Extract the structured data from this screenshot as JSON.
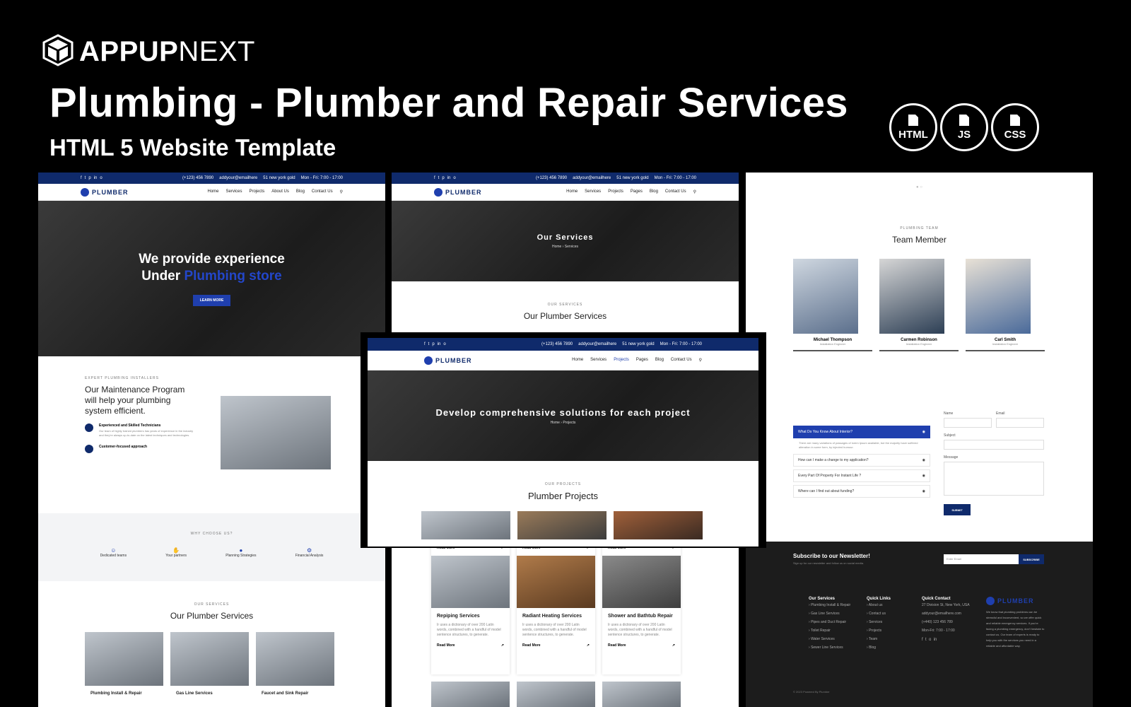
{
  "brand": {
    "logo_icon": "cube-icon",
    "name_bold": "APPUP",
    "name_light": "NEXT"
  },
  "headline": "Plumbing - Plumber and Repair Services",
  "subheadline": "HTML 5 Website Template",
  "tech_badges": [
    {
      "icon": "file-icon",
      "label": "HTML"
    },
    {
      "icon": "file-icon",
      "label": "JS"
    },
    {
      "icon": "file-icon",
      "label": "CSS"
    }
  ],
  "colors": {
    "navy": "#0f2a6b",
    "blue": "#1f3fae",
    "black": "#000000",
    "white": "#ffffff"
  },
  "site": {
    "logo_text": "PLUMBER",
    "topbar": {
      "phone": "(+123) 456 7890",
      "email": "addyour@emailhere",
      "address": "51 new york gold",
      "hours": "Mon - Fri: 7:00 - 17:00"
    },
    "menu_home": [
      "Home",
      "Services",
      "Projects",
      "About Us",
      "Blog",
      "Contact Us"
    ],
    "menu_inner": [
      "Home",
      "Services",
      "Projects",
      "Pages",
      "Blog",
      "Contact Us"
    ]
  },
  "home": {
    "hero_line1": "We provide experience",
    "hero_line2_plain": "Under ",
    "hero_line2_blue": "Plumbing store",
    "hero_button": "LEARN MORE",
    "about_eyebrow": "EXPERT PLUMBING INSTALLERS",
    "about_title": "Our Maintenance Program will help your plumbing system efficient.",
    "feature1_title": "Experienced and Skilled Technicians",
    "feature1_text": "Our team of highly trained plumbers has years of experience in the industry and they're always up-to-date on the latest techniques and technologies.",
    "feature2_title": "Customer-focused approach",
    "why_eyebrow": "WHY CHOOSE US?",
    "why_items": [
      "Dedicated teams",
      "Your partners",
      "Planning Strategies",
      "Financial Analysis"
    ],
    "services_eyebrow": "OUR SERVICES",
    "services_title": "Our Plumber Services",
    "services": [
      "Plumbing Install & Repair",
      "Gas Line Services",
      "Faucet and Sink Repair"
    ]
  },
  "services_page": {
    "hero_title": "Our Services",
    "crumb_home": "Home",
    "crumb_current": "Services",
    "eyebrow": "OUR SERVICES",
    "title": "Our Plumber Services",
    "read_more": "Read More",
    "cards": [
      {
        "title": "Repiping Services",
        "text": "Ir uses a dictionary of over 200 Latin words, combined with a handful of model sentence structures, to generate."
      },
      {
        "title": "Radiant Heating Services",
        "text": "Ir uses a dictionary of over 200 Latin words, combined with a handful of model sentence structures, to generate."
      },
      {
        "title": "Shower and Bathtub Repair",
        "text": "Ir uses a dictionary of over 200 Latin words, combined with a handful of model sentence structures, to generate."
      }
    ]
  },
  "projects_page": {
    "hero_title": "Develop comprehensive solutions for each project",
    "crumb_home": "Home",
    "crumb_current": "Projects",
    "eyebrow": "OUR PROJECTS",
    "title": "Plumber Projects"
  },
  "team_page": {
    "eyebrow": "PLUMBING TEAM",
    "title": "Team Member",
    "members": [
      {
        "name": "Michael Thompson",
        "role": "Installation Engineer"
      },
      {
        "name": "Carmen Robinson",
        "role": "Installation Engineer"
      },
      {
        "name": "Carl Smith",
        "role": "Installation Engineer"
      }
    ],
    "faq": [
      "What Do You Know About Interior?",
      "How can I make a change to my application?",
      "Every Part Of Property For Instant Life ?",
      "Where can I find out about funding?"
    ],
    "faq_answer": "There are many variations of passages of lorem Ipsum available, but the majority have suffered alteration in some form, by injected humour.",
    "form": {
      "name": "Name",
      "email": "Email",
      "subject": "Subject",
      "message": "Message",
      "submit": "SUBMIT"
    },
    "newsletter_title": "Subscribe to our Newsletter!",
    "newsletter_text": "Sign up for our newsletter and follow us on social media.",
    "newsletter_placeholder": "Enter Email",
    "newsletter_button": "SUBSCRIBE",
    "footer_services_h": "Our Services",
    "footer_services": [
      "Plumbing Install & Repair",
      "Gas Line Services",
      "Pipes and Duct Repair",
      "Toilet Repair",
      "Water Services",
      "Sewer Line Services"
    ],
    "footer_links_h": "Quick Links",
    "footer_links": [
      "About us",
      "Contact us",
      "Services",
      "Projects",
      "Team",
      "Blog"
    ],
    "footer_contact_h": "Quick Contact",
    "footer_contact": [
      "27 Division St, New York, USA",
      "addyour@emailhere.com",
      "(+440) 123 456 789",
      "Mon-Fri: 7:00 - 17:00"
    ],
    "footer_about": "We know that plumbing problems can be stressful and inconvenient, so we offer quick and reliable emergency services. If you're facing a plumbing emergency, don't hesitate to contact us. Our team of experts is ready to help you with the services you need in a reliable and affordable way.",
    "copyright": "© 2023 Powered By Plumber"
  }
}
